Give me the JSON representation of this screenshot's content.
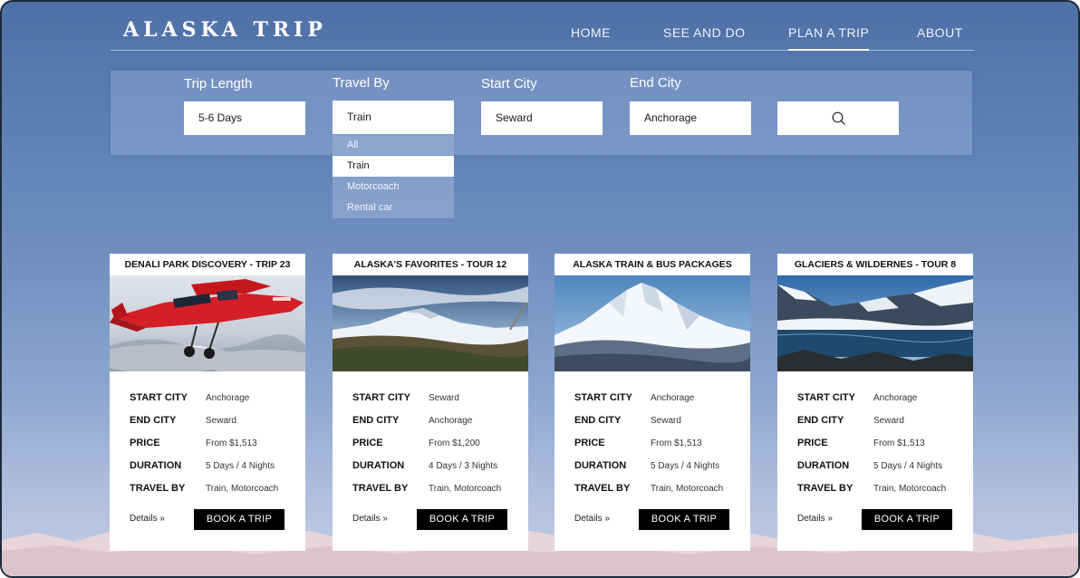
{
  "brand": {
    "logo": "ALASKA TRIP"
  },
  "nav": {
    "home": "HOME",
    "see_and_do": "SEE AND DO",
    "plan_a_trip": "PLAN A TRIP",
    "about": "ABOUT",
    "active": "PLAN A TRIP"
  },
  "search": {
    "trip_length": {
      "label": "Trip Length",
      "value": "5-6 Days"
    },
    "travel_by": {
      "label": "Travel By",
      "value": "Train",
      "options": [
        "All",
        "Train",
        "Motorcoach",
        "Rental car"
      ]
    },
    "start_city": {
      "label": "Start City",
      "value": "Seward"
    },
    "end_city": {
      "label": "End City",
      "value": "Anchorage"
    },
    "button_icon": "search-icon"
  },
  "spec_labels": {
    "start": "START CITY",
    "end": "END CITY",
    "price": "PRICE",
    "duration": "DURATION",
    "travel": "TRAVEL BY"
  },
  "card_actions": {
    "details": "Details",
    "book": "BOOK A TRIP"
  },
  "cards": [
    {
      "title": "DENALI PARK DISCOVERY - TRIP 23",
      "start": "Anchorage",
      "end": "Seward",
      "price": "From $1,513",
      "duration": "5 Days / 4 Nights",
      "travel": "Train, Motorcoach"
    },
    {
      "title": "ALASKA'S  FAVORITES - TOUR 12",
      "start": "Seward",
      "end": "Anchorage",
      "price": "From $1,200",
      "duration": "4 Days / 3 Nights",
      "travel": "Train, Motorcoach"
    },
    {
      "title": "ALASKA TRAIN & BUS PACKAGES",
      "start": "Anchorage",
      "end": "Seward",
      "price": "From $1,513",
      "duration": "5 Days / 4 Nights",
      "travel": "Train, Motorcoach"
    },
    {
      "title": "GLACIERS & WILDERNES - TOUR 8",
      "start": "Anchorage",
      "end": "Seward",
      "price": "From $1,513",
      "duration": "5 Days / 4 Nights",
      "travel": "Train, Motorcoach"
    }
  ],
  "colors": {
    "sky": "#5b7db2",
    "button": "#000000",
    "card": "#ffffff"
  }
}
